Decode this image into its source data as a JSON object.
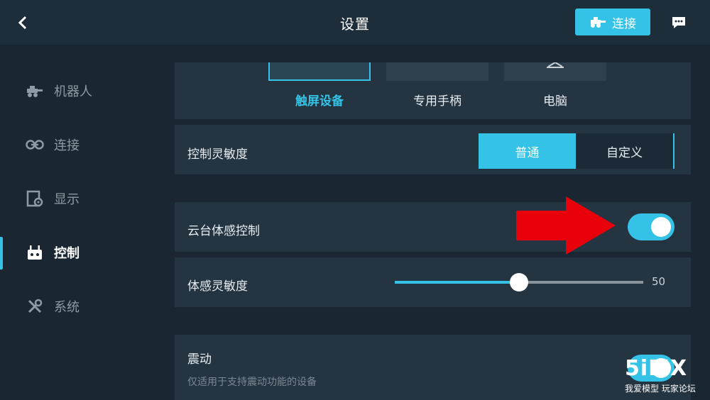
{
  "header": {
    "title": "设置",
    "connect_label": "连接"
  },
  "sidebar": {
    "items": [
      {
        "label": "机器人",
        "icon": "robot-icon"
      },
      {
        "label": "连接",
        "icon": "link-icon"
      },
      {
        "label": "显示",
        "icon": "display-settings-icon"
      },
      {
        "label": "控制",
        "icon": "gamepad-icon",
        "active": true
      },
      {
        "label": "系统",
        "icon": "tools-icon"
      }
    ]
  },
  "control": {
    "devices": [
      {
        "label": "触屏设备",
        "selected": true
      },
      {
        "label": "专用手柄",
        "selected": false
      },
      {
        "label": "电脑",
        "selected": false
      }
    ],
    "sensitivity": {
      "label": "控制灵敏度",
      "options": [
        "普通",
        "自定义"
      ],
      "selected": "普通"
    },
    "gimbal_motion": {
      "label": "云台体感控制",
      "enabled": true
    },
    "motion_sensitivity": {
      "label": "体感灵敏度",
      "value": "50",
      "fraction": 0.5
    },
    "vibration": {
      "label": "震动",
      "description": "仅适用于支持震动功能的设备",
      "enabled": true
    }
  },
  "watermark": {
    "logo": "5iMX",
    "subtitle": "我爱模型 玩家论坛"
  },
  "colors": {
    "accent": "#34c3e6",
    "annotation": "#e8000b"
  }
}
